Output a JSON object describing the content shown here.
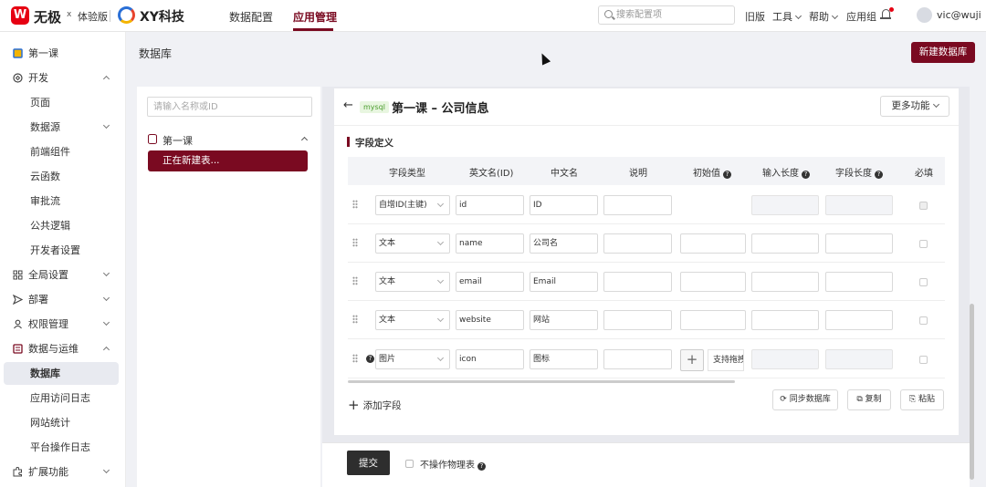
{
  "header": {
    "logo_mark": "W",
    "brand": "无极",
    "times": "x",
    "edition": "体验版",
    "org": "XY科技",
    "tabs": [
      {
        "label": "数据配置"
      },
      {
        "label": "应用管理",
        "active": true
      }
    ],
    "search_placeholder": "搜索配置项",
    "links": {
      "legacy": "旧版",
      "tools": "工具",
      "help": "帮助",
      "app_group": "应用组"
    },
    "username": "vic@wuji"
  },
  "sidebar": {
    "items": [
      {
        "label": "第一课",
        "icon": "book-icon"
      },
      {
        "label": "开发",
        "icon": "code-icon",
        "expanded": true
      },
      {
        "label": "页面",
        "sub": true
      },
      {
        "label": "数据源",
        "sub": true,
        "chevron": "down"
      },
      {
        "label": "前端组件",
        "sub": true
      },
      {
        "label": "云函数",
        "sub": true
      },
      {
        "label": "审批流",
        "sub": true
      },
      {
        "label": "公共逻辑",
        "sub": true
      },
      {
        "label": "开发者设置",
        "sub": true
      },
      {
        "label": "全局设置",
        "icon": "grid-icon",
        "chevron": "down"
      },
      {
        "label": "部署",
        "icon": "send-icon",
        "chevron": "down"
      },
      {
        "label": "权限管理",
        "icon": "user-icon",
        "chevron": "down"
      },
      {
        "label": "数据与运维",
        "icon": "database-icon",
        "expanded": true
      },
      {
        "label": "数据库",
        "sub": true,
        "selected": true
      },
      {
        "label": "应用访问日志",
        "sub": true
      },
      {
        "label": "网站统计",
        "sub": true
      },
      {
        "label": "平台操作日志",
        "sub": true
      },
      {
        "label": "扩展功能",
        "icon": "puzzle-icon",
        "chevron": "down"
      }
    ]
  },
  "page": {
    "title": "数据库",
    "new_button": "新建数据库"
  },
  "left_panel": {
    "search_placeholder": "请输入名称或ID",
    "db_name": "第一课",
    "creating": "正在新建表..."
  },
  "editor": {
    "back": "←",
    "db_type": "mysql",
    "title": "第一课 – 公司信息",
    "more_button": "更多功能",
    "section": "字段定义",
    "columns": [
      "字段类型",
      "英文名(ID)",
      "中文名",
      "说明",
      "初始值",
      "输入长度",
      "字段长度",
      "必填"
    ],
    "rows": [
      {
        "type": "自增ID(主键)",
        "en": "id",
        "cn": "ID",
        "desc": "",
        "init": "",
        "init_disabled": true,
        "input_len_disabled": true,
        "field_len_disabled": true,
        "required_disabled": true
      },
      {
        "type": "文本",
        "en": "name",
        "cn": "公司名",
        "desc": "",
        "init": ""
      },
      {
        "type": "文本",
        "en": "email",
        "cn": "Email",
        "desc": "",
        "init": ""
      },
      {
        "type": "文本",
        "en": "website",
        "cn": "网站",
        "desc": "",
        "init": ""
      },
      {
        "type": "图片",
        "en": "icon",
        "cn": "图标",
        "desc": "",
        "upload_text": "支持拖拽",
        "has_help": true,
        "input_len_disabled": true,
        "field_len_disabled": true
      }
    ],
    "add_field": "添加字段",
    "actions": {
      "sync": "同步数据库",
      "copy": "复制",
      "paste": "粘贴"
    }
  },
  "footer": {
    "submit": "提交",
    "no_physical": "不操作物理表"
  },
  "colors": {
    "brand": "#7a0a21",
    "logo_red": "#e60012",
    "mysql_green": "#4a9c2d"
  }
}
